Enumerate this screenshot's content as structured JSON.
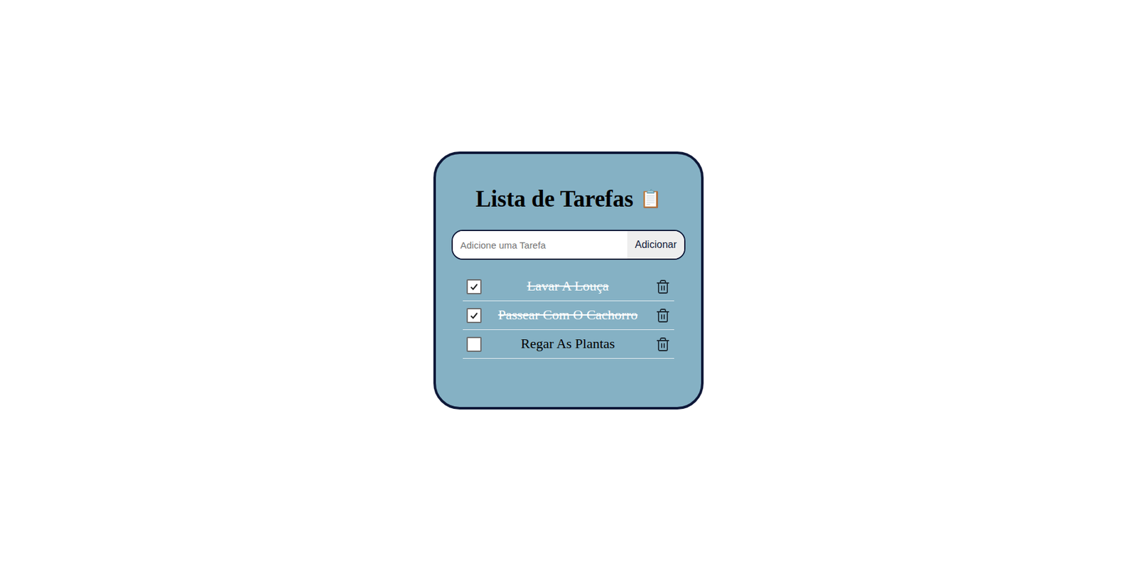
{
  "app": {
    "title": "Lista de Tarefas",
    "title_icon": "📋"
  },
  "input": {
    "placeholder": "Adicione uma Tarefa",
    "value": ""
  },
  "add_button": {
    "label": "Adicionar"
  },
  "tasks": [
    {
      "text": "Lavar A Louça",
      "checked": true
    },
    {
      "text": "Passear Com O Cachorro",
      "checked": true
    },
    {
      "text": "Regar As Plantas",
      "checked": false
    }
  ]
}
